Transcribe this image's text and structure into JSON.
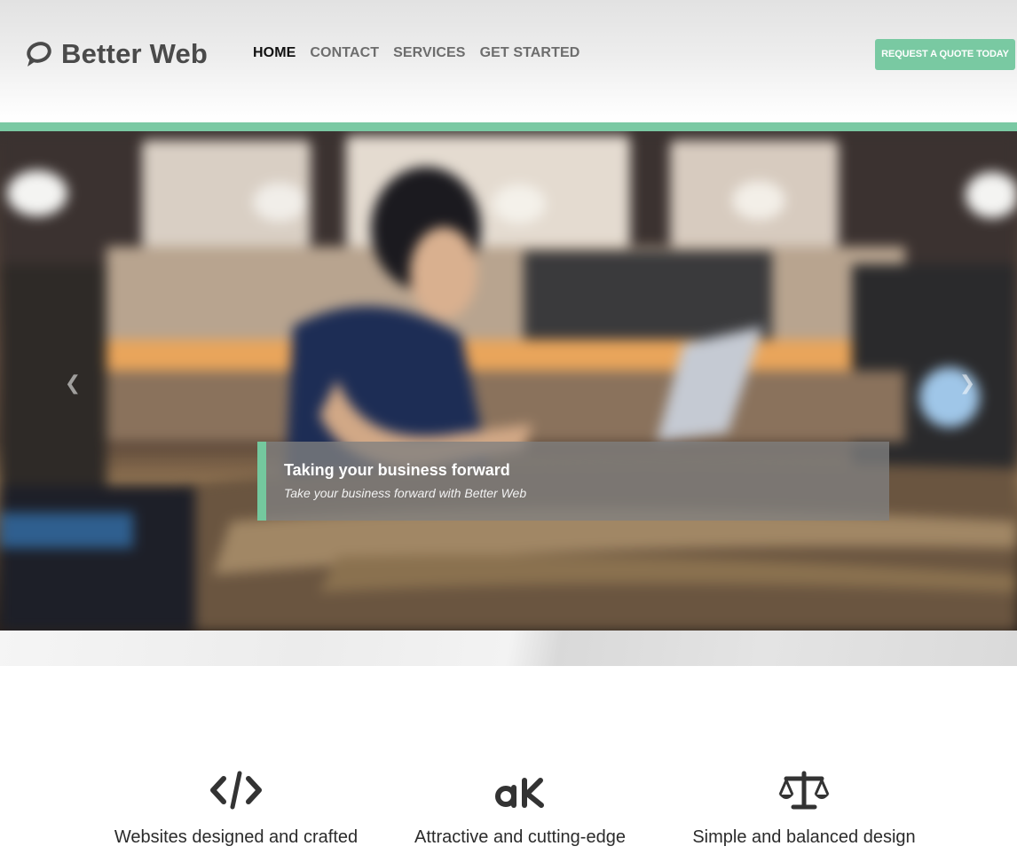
{
  "brand": {
    "name": "Better Web"
  },
  "nav": {
    "items": [
      {
        "label": "HOME",
        "active": true
      },
      {
        "label": "CONTACT",
        "active": false
      },
      {
        "label": "SERVICES",
        "active": false
      },
      {
        "label": "GET STARTED",
        "active": false
      }
    ]
  },
  "header": {
    "cta_label": "REQUEST A QUOTE TODAY"
  },
  "hero": {
    "caption_title": "Taking your business forward",
    "caption_subtitle": "Take your business forward with Better Web",
    "prev_icon": "chevron-left-icon",
    "next_icon": "chevron-right-icon"
  },
  "features": [
    {
      "icon": "code-icon",
      "text": "Websites designed and crafted"
    },
    {
      "icon": "font-icon",
      "text": "Attractive and cutting-edge"
    },
    {
      "icon": "balance-scale-icon",
      "text": "Simple and balanced design"
    }
  ],
  "colors": {
    "accent": "#79c9a2",
    "nav_text": "#6d6d6d",
    "nav_active": "#111111",
    "logo_text": "#4a4a4a",
    "caption_bg": "#808080"
  }
}
